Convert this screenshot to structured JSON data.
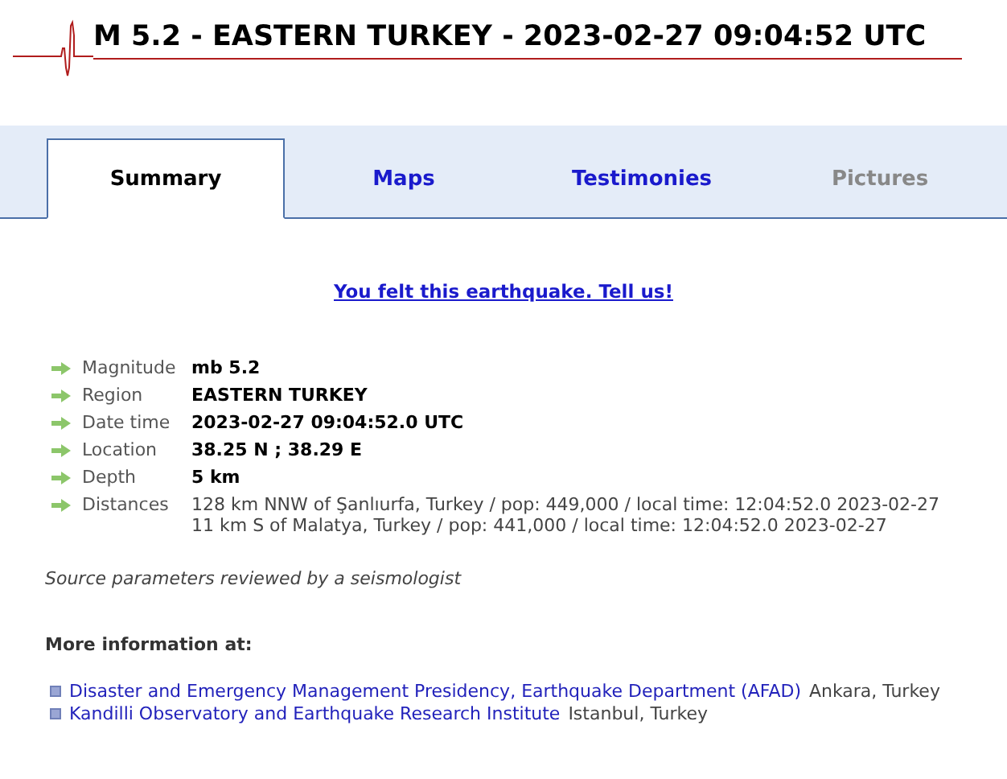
{
  "title": "M 5.2 - EASTERN TURKEY - 2023-02-27 09:04:52 UTC",
  "tabs": [
    {
      "label": "Summary",
      "selected": true,
      "disabled": false
    },
    {
      "label": "Maps",
      "selected": false,
      "disabled": false
    },
    {
      "label": "Testimonies",
      "selected": false,
      "disabled": false
    },
    {
      "label": "Pictures",
      "selected": false,
      "disabled": true
    }
  ],
  "felt_link": "You felt this earthquake. Tell us!",
  "parameters": [
    {
      "label": "Magnitude",
      "values": [
        "mb 5.2"
      ],
      "kind": "bold"
    },
    {
      "label": "Region",
      "values": [
        "EASTERN TURKEY"
      ],
      "kind": "bold"
    },
    {
      "label": "Date time",
      "values": [
        "2023-02-27 09:04:52.0 UTC"
      ],
      "kind": "bold"
    },
    {
      "label": "Location",
      "values": [
        "38.25 N ; 38.29 E"
      ],
      "kind": "bold"
    },
    {
      "label": "Depth",
      "values": [
        "5 km"
      ],
      "kind": "bold"
    },
    {
      "label": "Distances",
      "values": [
        "128 km NNW of Şanlıurfa, Turkey / pop: 449,000 / local time: 12:04:52.0 2023-02-27",
        "11 km S of Malatya, Turkey / pop: 441,000 / local time: 12:04:52.0 2023-02-27"
      ],
      "kind": "plain"
    }
  ],
  "review_note": "Source parameters reviewed by a seismologist",
  "more_info": {
    "heading": "More information at:",
    "links": [
      {
        "name": "Disaster and Emergency Management Presidency, Earthquake Department (AFAD)",
        "place": "Ankara, Turkey"
      },
      {
        "name": "Kandilli Observatory and Earthquake Research Institute",
        "place": "Istanbul, Turkey"
      }
    ]
  }
}
